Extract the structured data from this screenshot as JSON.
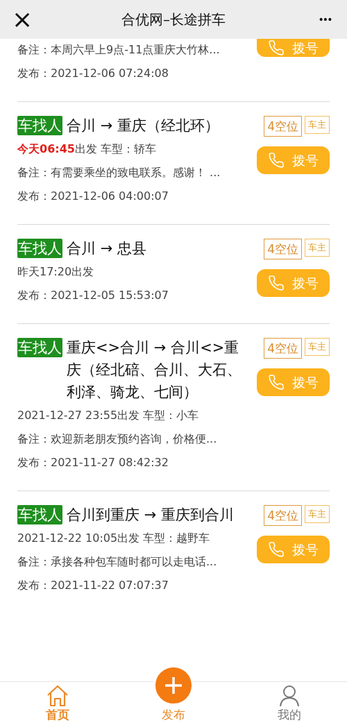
{
  "header": {
    "close": "×",
    "title": "合优网–长途拼车",
    "more": "•••"
  },
  "listings": [
    {
      "kind": "partial",
      "call": "拨号",
      "remark": "备注：本周六早上9点-11点重庆大竹林...",
      "published": "发布：2021-12-06 07:24:08"
    },
    {
      "kind": "full",
      "tag": "车找人",
      "route": "合川 → 重庆（经北环）",
      "seats": "4空位",
      "role": "车主",
      "call": "拨号",
      "depart_highlight": "今天06:45",
      "depart_rest": "出发 车型：轿车",
      "remark": "备注：有需要乘坐的致电联系。感谢！ ...",
      "published": "发布：2021-12-06 04:00:07"
    },
    {
      "kind": "full",
      "tag": "车找人",
      "route": "合川 → 忠县",
      "seats": "4空位",
      "role": "车主",
      "call": "拨号",
      "depart_rest": "昨天17:20出发",
      "published": "发布：2021-12-05 15:53:07"
    },
    {
      "kind": "full",
      "tag": "车找人",
      "route": "重庆<>合川 → 合川<>重庆（经北碚、合川、大石、利泽、骑龙、七间）",
      "seats": "4空位",
      "role": "车主",
      "call": "拨号",
      "depart_rest": "2021-12-27 23:55出发 车型：小车",
      "remark": "备注：欢迎新老朋友预约咨询，价格便...",
      "published": "发布：2021-11-27 08:42:32"
    },
    {
      "kind": "full",
      "tag": "车找人",
      "route": "合川到重庆 → 重庆到合川",
      "seats": "4空位",
      "role": "车主",
      "call": "拨号",
      "depart_rest": "2021-12-22 10:05出发 车型：越野车",
      "remark": "备注：承接各种包车随时都可以走电话...",
      "published": "发布：2021-11-22 07:07:37"
    }
  ],
  "nav": [
    {
      "kind": "home",
      "label": "首页",
      "selected": true
    },
    {
      "kind": "publish",
      "label": "发布",
      "selected": false
    },
    {
      "kind": "profile",
      "label": "我的",
      "selected": false
    }
  ]
}
